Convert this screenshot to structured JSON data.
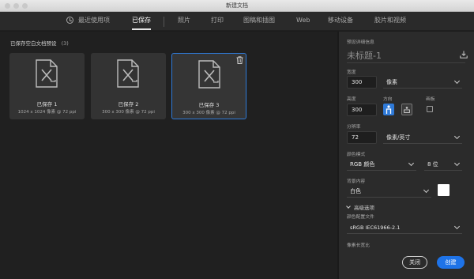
{
  "window": {
    "title": "新建文档"
  },
  "tabs": [
    {
      "label": "最近使用项",
      "active": false
    },
    {
      "label": "已保存",
      "active": true
    },
    {
      "label": "照片",
      "active": false
    },
    {
      "label": "打印",
      "active": false
    },
    {
      "label": "图稿和插图",
      "active": false
    },
    {
      "label": "Web",
      "active": false
    },
    {
      "label": "移动设备",
      "active": false
    },
    {
      "label": "胶片和视频",
      "active": false
    }
  ],
  "saved": {
    "heading": "已保存空白文档预设",
    "count": "(3)",
    "presets": [
      {
        "name": "已保存 1",
        "size": "1024 x 1024 像素 @ 72 ppi",
        "selected": false
      },
      {
        "name": "已保存 2",
        "size": "300 x 300 像素 @ 72 ppi",
        "selected": false
      },
      {
        "name": "已保存 3",
        "size": "300 x 300 像素 @ 72 ppi",
        "selected": true
      }
    ]
  },
  "details": {
    "header": "预设详细信息",
    "doc_name": "未标题-1",
    "width_label": "宽度",
    "width_value": "300",
    "width_unit": "像素",
    "height_label": "高度",
    "height_value": "300",
    "orientation_label": "方向",
    "artboard_label": "画板",
    "resolution_label": "分辨率",
    "resolution_value": "72",
    "resolution_unit": "像素/英寸",
    "color_mode_label": "颜色模式",
    "color_mode_value": "RGB 颜色",
    "bit_depth": "8 位",
    "background_label": "背景内容",
    "background_value": "白色",
    "advanced_label": "高级选项",
    "profile_label": "颜色配置文件",
    "profile_value": "sRGB IEC61966-2.1",
    "pixel_aspect_label": "像素长宽比",
    "close_button": "关闭",
    "create_button": "创建"
  },
  "colors": {
    "accent": "#1e73e8",
    "selection": "#2f7ad8",
    "background_swatch": "#ffffff"
  }
}
